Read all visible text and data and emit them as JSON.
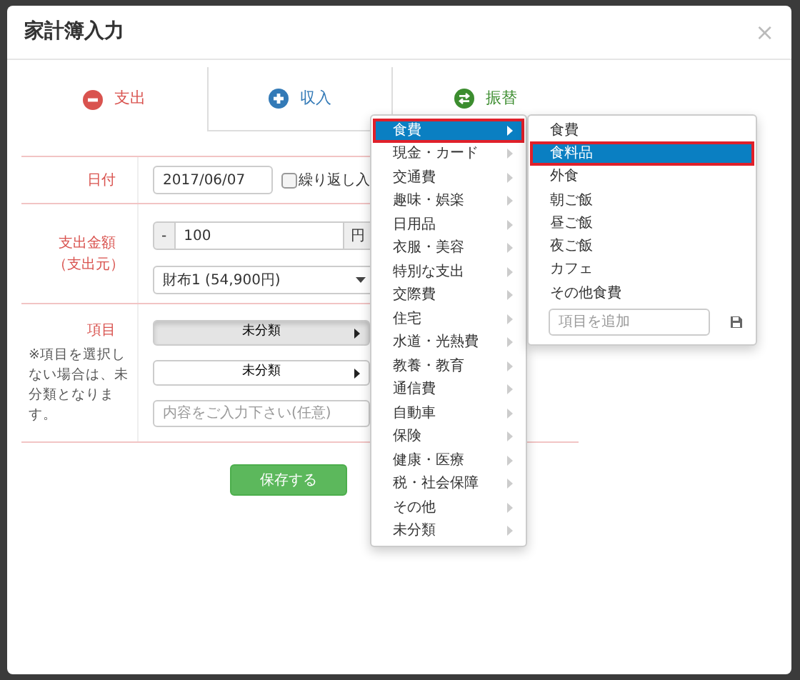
{
  "dialog": {
    "title": "家計簿入力",
    "close": "×"
  },
  "tabs": [
    {
      "label": "支出",
      "kind": "minus",
      "color": "#d9534f",
      "selected": true
    },
    {
      "label": "収入",
      "kind": "plus",
      "color": "#337ab7",
      "selected": false
    },
    {
      "label": "振替",
      "kind": "transfer",
      "color": "#3c8d2f",
      "selected": false
    }
  ],
  "form": {
    "date_label": "日付",
    "date": "2017/06/07",
    "repeat": {
      "label": "繰り返し入",
      "checked": false
    },
    "amount_label": "支出金額",
    "amount_sub": "（支出元）",
    "sign": "-",
    "amount": "100",
    "unit": "円",
    "source": "財布1 (54,900円)",
    "item_label": "項目",
    "item_note": "※項目を選択しない場合は、未分類となります。",
    "category_buttons": [
      {
        "label": "未分類",
        "active": true
      },
      {
        "label": "未分類",
        "active": false
      }
    ],
    "memo_placeholder": "内容をご入力下さい(任意)"
  },
  "save": "保存する",
  "menu": {
    "items": [
      {
        "label": "食費",
        "selected": true
      },
      {
        "label": "現金・カード",
        "selected": false
      },
      {
        "label": "交通費",
        "selected": false
      },
      {
        "label": "趣味・娯楽",
        "selected": false
      },
      {
        "label": "日用品",
        "selected": false
      },
      {
        "label": "衣服・美容",
        "selected": false
      },
      {
        "label": "特別な支出",
        "selected": false
      },
      {
        "label": "交際費",
        "selected": false
      },
      {
        "label": "住宅",
        "selected": false
      },
      {
        "label": "水道・光熱費",
        "selected": false
      },
      {
        "label": "教養・教育",
        "selected": false
      },
      {
        "label": "通信費",
        "selected": false
      },
      {
        "label": "自動車",
        "selected": false
      },
      {
        "label": "保険",
        "selected": false
      },
      {
        "label": "健康・医療",
        "selected": false
      },
      {
        "label": "税・社会保障",
        "selected": false
      },
      {
        "label": "その他",
        "selected": false
      },
      {
        "label": "未分類",
        "selected": false
      }
    ]
  },
  "submenu": {
    "items": [
      {
        "label": "食費",
        "selected": false
      },
      {
        "label": "食料品",
        "selected": true
      },
      {
        "label": "外食",
        "selected": false
      },
      {
        "label": "朝ご飯",
        "selected": false
      },
      {
        "label": "昼ご飯",
        "selected": false
      },
      {
        "label": "夜ご飯",
        "selected": false
      },
      {
        "label": "カフェ",
        "selected": false
      },
      {
        "label": "その他食費",
        "selected": false
      }
    ],
    "add_placeholder": "項目を追加"
  }
}
